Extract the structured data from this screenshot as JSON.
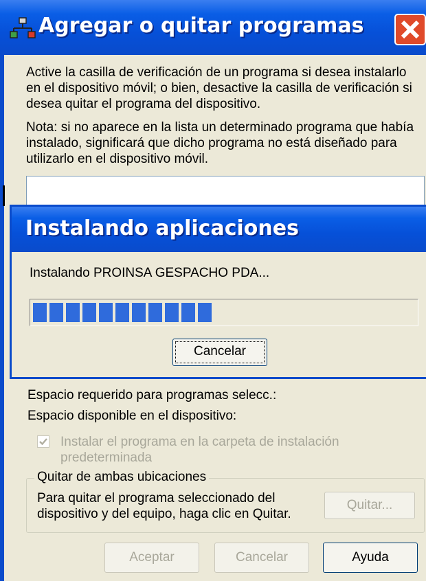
{
  "window": {
    "title": "Agregar o quitar programas",
    "description": "Active la casilla de verificación de un programa si desea instalarlo en el dispositivo móvil; o bien, desactive la casilla de verificación si desea quitar el programa del dispositivo.",
    "note": "Nota: si no aparece en la lista un determinado programa que había instalado, significará que dicho programa no está diseñado para utilizarlo en el dispositivo móvil."
  },
  "dialog": {
    "title": "Instalando aplicaciones",
    "message": "Instalando PROINSA GESPACHO PDA...",
    "progress": 0.47,
    "cancel_label": "Cancelar"
  },
  "space": {
    "required_label": "Espacio requerido para programas selecc.:",
    "available_label": "Espacio disponible en el dispositivo:"
  },
  "install_default": {
    "label": "Instalar el programa en la carpeta de instalación predeterminada",
    "checked": true
  },
  "remove_group": {
    "legend": "Quitar de ambas ubicaciones",
    "text": "Para quitar el programa seleccionado del dispositivo y del equipo, haga clic en Quitar.",
    "remove_label": "Quitar..."
  },
  "footer": {
    "ok_label": "Aceptar",
    "cancel_label": "Cancelar",
    "help_label": "Ayuda"
  },
  "icons": {
    "title_icon": "network-install-icon",
    "close_icon": "close-icon"
  },
  "colors": {
    "titlebar": "#0a5ee6",
    "close_button": "#e04a2a",
    "progress": "#2f6bdc",
    "face": "#ece9d8"
  }
}
